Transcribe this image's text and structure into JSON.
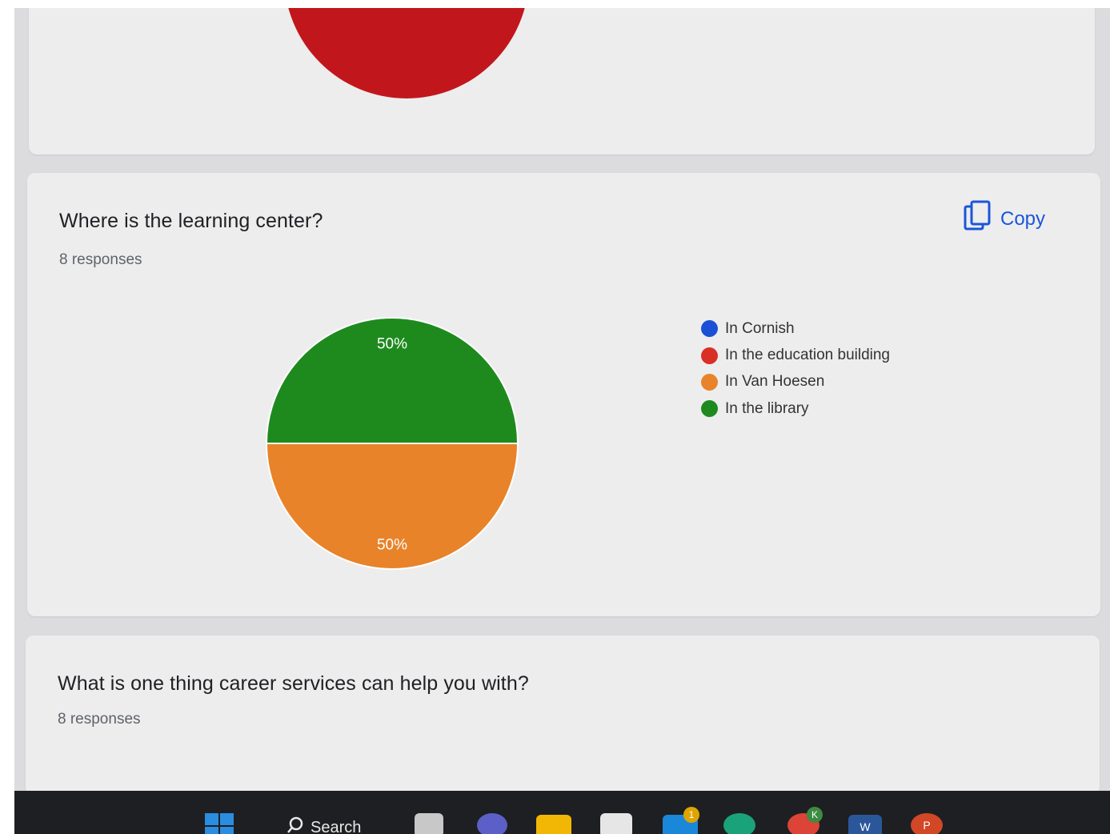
{
  "questions": [
    {
      "title": "",
      "responses": ""
    },
    {
      "title": "Where is the learning center?",
      "responses": "8 responses"
    },
    {
      "title": "What is one thing career services can help you with?",
      "responses": "8 responses"
    }
  ],
  "copy_label": "Copy",
  "chart_data": {
    "type": "pie",
    "labels": [
      "In Cornish",
      "In the education building",
      "In Van Hoesen",
      "In the library"
    ],
    "values": [
      0,
      0,
      50,
      50
    ],
    "data_labels": [
      "",
      "",
      "50%",
      "50%"
    ],
    "colors": [
      "#1a4fd6",
      "#d93025",
      "#e8832a",
      "#1e8a1e"
    ],
    "legend_position": "right"
  },
  "taskbar": {
    "search_label": "Search",
    "mail_badge": "1",
    "chrome_badge": "K",
    "word_letter": "W",
    "powerpoint_letter": "P"
  },
  "icons": {
    "copy": "copy-icon",
    "windows": "windows-start-icon",
    "search": "search-icon"
  }
}
